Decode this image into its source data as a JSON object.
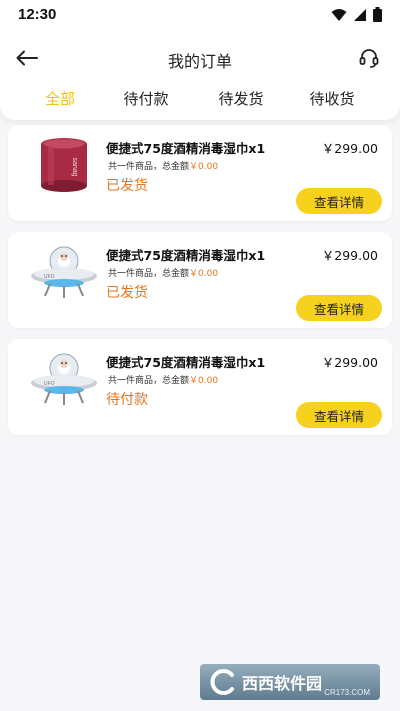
{
  "status_bar": {
    "time": "12:30",
    "icons": [
      "wifi-icon",
      "signal-icon",
      "battery-icon"
    ]
  },
  "header": {
    "title": "我的订单",
    "back_icon": "arrow-left-icon",
    "service_icon": "headset-icon",
    "tabs": [
      {
        "label": "全部",
        "active": true
      },
      {
        "label": "待付款",
        "active": false
      },
      {
        "label": "待发货",
        "active": false
      },
      {
        "label": "待收货",
        "active": false
      }
    ]
  },
  "orders": [
    {
      "product_name": "便捷式75度酒精消毒湿巾x1",
      "price": "￥299.00",
      "summary_prefix": "共一件商品，总金额",
      "summary_amount": "￥0.00",
      "status": "已发货",
      "button": "查看详情",
      "thumb": "speaker",
      "thumb_text": "sanag"
    },
    {
      "product_name": "便捷式75度酒精消毒湿巾x1",
      "price": "￥299.00",
      "summary_prefix": "共一件商品，总金额",
      "summary_amount": "￥0.00",
      "status": "已发货",
      "button": "查看详情",
      "thumb": "ufo",
      "thumb_text": "UFO"
    },
    {
      "product_name": "便捷式75度酒精消毒湿巾x1",
      "price": "￥299.00",
      "summary_prefix": "共一件商品，总金额",
      "summary_amount": "￥0.00",
      "status": "待付款",
      "button": "查看详情",
      "thumb": "ufo",
      "thumb_text": "UFO"
    }
  ],
  "watermark": {
    "text": "西西软件园",
    "sub": "CR173.COM"
  },
  "colors": {
    "accent": "#f4c20d",
    "status": "#e8751a",
    "button": "#f6d21e",
    "background": "#f6f6f8"
  }
}
